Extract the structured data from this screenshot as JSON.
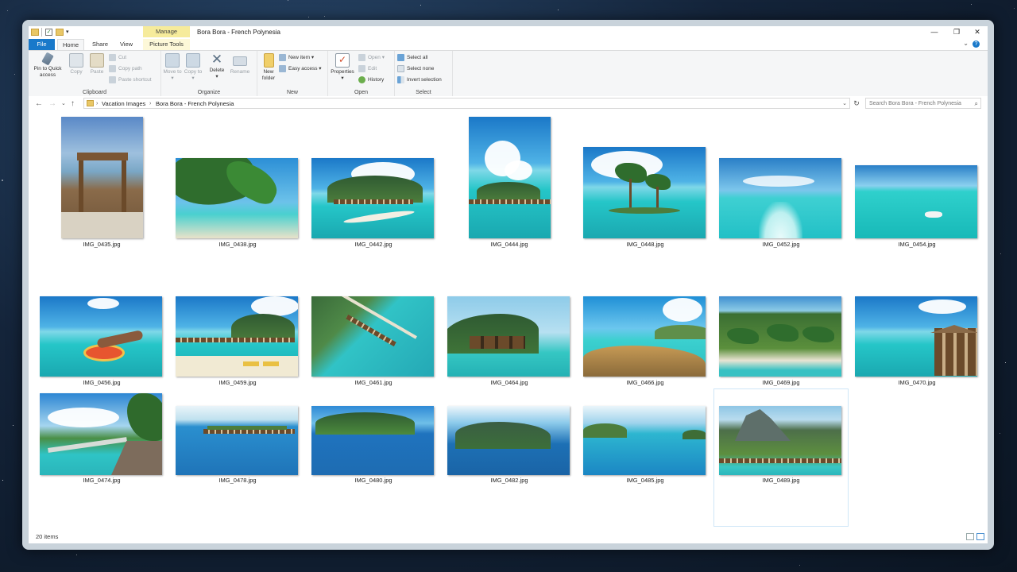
{
  "window": {
    "title": "Bora Bora - French Polynesia",
    "contextual_tab": "Manage"
  },
  "tabs": [
    {
      "label": "File"
    },
    {
      "label": "Home"
    },
    {
      "label": "Share"
    },
    {
      "label": "View"
    },
    {
      "label": "Picture Tools"
    }
  ],
  "ribbon": {
    "clipboard": {
      "label": "Clipboard",
      "pin": "Pin to Quick access",
      "copy": "Copy",
      "paste": "Paste",
      "cut": "Cut",
      "copy_path": "Copy path",
      "paste_shortcut": "Paste shortcut"
    },
    "organize": {
      "label": "Organize",
      "move_to": "Move to",
      "copy_to": "Copy to",
      "delete": "Delete",
      "rename": "Rename"
    },
    "new": {
      "label": "New",
      "new_folder": "New folder",
      "new_item": "New item",
      "easy_access": "Easy access"
    },
    "open": {
      "label": "Open",
      "properties": "Properties",
      "open": "Open",
      "edit": "Edit",
      "history": "History"
    },
    "select": {
      "label": "Select",
      "select_all": "Select all",
      "select_none": "Select none",
      "invert": "Invert selection"
    }
  },
  "address": {
    "crumbs": [
      "Vacation Images",
      "Bora Bora - French Polynesia"
    ],
    "search_placeholder": "Search Bora Bora - French Polynesia"
  },
  "files": [
    {
      "name": "IMG_0435.jpg"
    },
    {
      "name": "IMG_0438.jpg"
    },
    {
      "name": "IMG_0442.jpg"
    },
    {
      "name": "IMG_0444.jpg"
    },
    {
      "name": "IMG_0448.jpg"
    },
    {
      "name": "IMG_0452.jpg"
    },
    {
      "name": "IMG_0454.jpg"
    },
    {
      "name": "IMG_0456.jpg"
    },
    {
      "name": "IMG_0459.jpg"
    },
    {
      "name": "IMG_0461.jpg"
    },
    {
      "name": "IMG_0464.jpg"
    },
    {
      "name": "IMG_0466.jpg"
    },
    {
      "name": "IMG_0469.jpg"
    },
    {
      "name": "IMG_0470.jpg"
    },
    {
      "name": "IMG_0474.jpg"
    },
    {
      "name": "IMG_0478.jpg"
    },
    {
      "name": "IMG_0480.jpg"
    },
    {
      "name": "IMG_0482.jpg"
    },
    {
      "name": "IMG_0485.jpg"
    },
    {
      "name": "IMG_0489.jpg"
    }
  ],
  "status": {
    "count": "20 items"
  }
}
